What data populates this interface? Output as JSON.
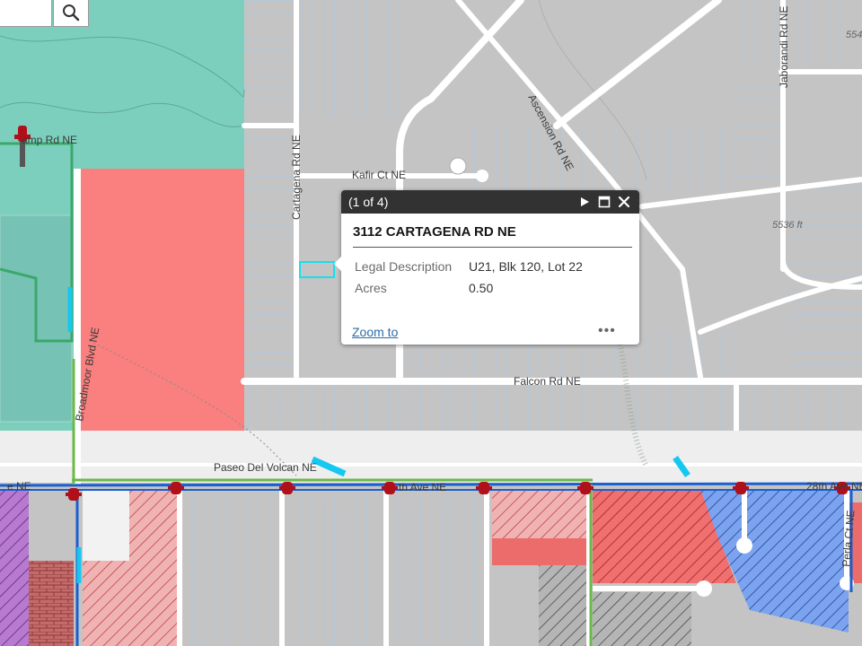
{
  "map": {
    "street_labels": {
      "cartagena": "Cartagena Rd NE",
      "kafir": "Kafir Ct NE",
      "ascension": "Ascension Rd NE",
      "jaborandi": "Jaborandi Rd NE",
      "falcon": "Falcon Rd NE",
      "paseo": "Paseo Del Volcan NE",
      "broadmoor": "Broadmoor Blvd NE",
      "ave_28th": "28th Ave NE",
      "ave_mid": "th Ave NE",
      "ave_left": "e NE",
      "perla": "Perla Ct NE",
      "hunt": "amp Rd NE"
    },
    "elevation_labels": {
      "e1": "5536 ft",
      "e2": "554"
    },
    "colors": {
      "base": "#c4c4c4",
      "teal_zone": "#7dcfbd",
      "red_parcel": "#fa7f7f",
      "road": "#ffffff",
      "parcel_line": "#a6c8e8",
      "blue_line": "#1a5fd0",
      "green_line": "#6cb84a",
      "hydrant": "#b0101a"
    }
  },
  "search": {
    "icon": "search-icon"
  },
  "popup": {
    "count": "(1 of 4)",
    "title": "3112 CARTAGENA RD NE",
    "fields": [
      {
        "label": "Legal Description",
        "value": "U21, Blk 120, Lot 22"
      },
      {
        "label": "Acres",
        "value": "0.50"
      }
    ],
    "zoom_link": "Zoom to",
    "more": "•••",
    "icons": {
      "next": "play-icon",
      "maximize": "maximize-icon",
      "close": "close-icon"
    }
  }
}
